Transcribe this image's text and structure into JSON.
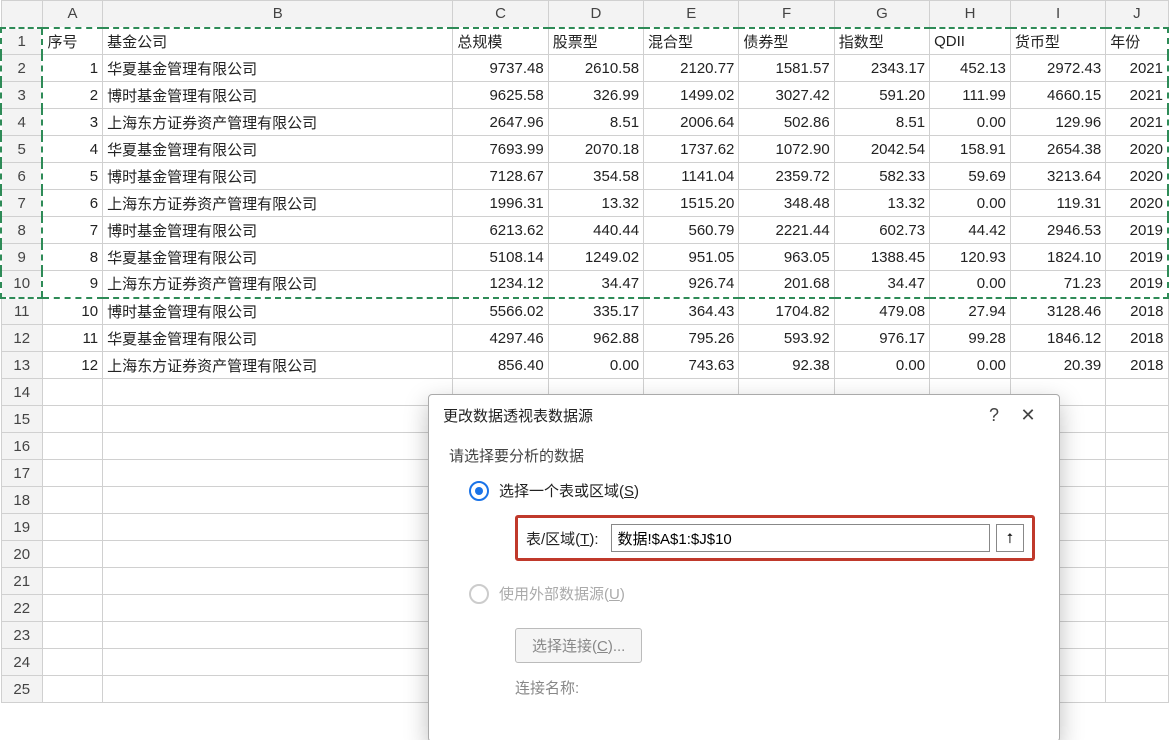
{
  "columns": {
    "letters": [
      "",
      "A",
      "B",
      "C",
      "D",
      "E",
      "F",
      "G",
      "H",
      "I",
      "J"
    ]
  },
  "headers": {
    "A": "序号",
    "B": "基金公司",
    "C": "总规模",
    "D": "股票型",
    "E": "混合型",
    "F": "债券型",
    "G": "指数型",
    "H": "QDII",
    "I": "货币型",
    "J": "年份"
  },
  "rows": [
    {
      "n": "1",
      "co": "华夏基金管理有限公司",
      "c": "9737.48",
      "d": "2610.58",
      "e": "2120.77",
      "f": "1581.57",
      "g": "2343.17",
      "h": "452.13",
      "i": "2972.43",
      "j": "2021"
    },
    {
      "n": "2",
      "co": "博时基金管理有限公司",
      "c": "9625.58",
      "d": "326.99",
      "e": "1499.02",
      "f": "3027.42",
      "g": "591.20",
      "h": "111.99",
      "i": "4660.15",
      "j": "2021"
    },
    {
      "n": "3",
      "co": "上海东方证券资产管理有限公司",
      "c": "2647.96",
      "d": "8.51",
      "e": "2006.64",
      "f": "502.86",
      "g": "8.51",
      "h": "0.00",
      "i": "129.96",
      "j": "2021"
    },
    {
      "n": "4",
      "co": "华夏基金管理有限公司",
      "c": "7693.99",
      "d": "2070.18",
      "e": "1737.62",
      "f": "1072.90",
      "g": "2042.54",
      "h": "158.91",
      "i": "2654.38",
      "j": "2020"
    },
    {
      "n": "5",
      "co": "博时基金管理有限公司",
      "c": "7128.67",
      "d": "354.58",
      "e": "1141.04",
      "f": "2359.72",
      "g": "582.33",
      "h": "59.69",
      "i": "3213.64",
      "j": "2020"
    },
    {
      "n": "6",
      "co": "上海东方证券资产管理有限公司",
      "c": "1996.31",
      "d": "13.32",
      "e": "1515.20",
      "f": "348.48",
      "g": "13.32",
      "h": "0.00",
      "i": "119.31",
      "j": "2020"
    },
    {
      "n": "7",
      "co": "博时基金管理有限公司",
      "c": "6213.62",
      "d": "440.44",
      "e": "560.79",
      "f": "2221.44",
      "g": "602.73",
      "h": "44.42",
      "i": "2946.53",
      "j": "2019"
    },
    {
      "n": "8",
      "co": "华夏基金管理有限公司",
      "c": "5108.14",
      "d": "1249.02",
      "e": "951.05",
      "f": "963.05",
      "g": "1388.45",
      "h": "120.93",
      "i": "1824.10",
      "j": "2019"
    },
    {
      "n": "9",
      "co": "上海东方证券资产管理有限公司",
      "c": "1234.12",
      "d": "34.47",
      "e": "926.74",
      "f": "201.68",
      "g": "34.47",
      "h": "0.00",
      "i": "71.23",
      "j": "2019"
    },
    {
      "n": "10",
      "co": "博时基金管理有限公司",
      "c": "5566.02",
      "d": "335.17",
      "e": "364.43",
      "f": "1704.82",
      "g": "479.08",
      "h": "27.94",
      "i": "3128.46",
      "j": "2018"
    },
    {
      "n": "11",
      "co": "华夏基金管理有限公司",
      "c": "4297.46",
      "d": "962.88",
      "e": "795.26",
      "f": "593.92",
      "g": "976.17",
      "h": "99.28",
      "i": "1846.12",
      "j": "2018"
    },
    {
      "n": "12",
      "co": "上海东方证券资产管理有限公司",
      "c": "856.40",
      "d": "0.00",
      "e": "743.63",
      "f": "92.38",
      "g": "0.00",
      "h": "0.00",
      "i": "20.39",
      "j": "2018"
    }
  ],
  "empty_rows": [
    "14",
    "15",
    "16",
    "17",
    "18",
    "19",
    "20",
    "21",
    "22",
    "23",
    "24",
    "25"
  ],
  "dialog": {
    "title": "更改数据透视表数据源",
    "help": "?",
    "close": "✕",
    "prompt": "请选择要分析的数据",
    "opt1_prefix": "选择一个表或区域(",
    "opt1_u": "S",
    "opt1_suffix": ")",
    "range_label_prefix": "表/区域(",
    "range_label_u": "T",
    "range_label_suffix": "):",
    "range_value": "数据!$A$1:$J$10",
    "pick_icon": "⭡",
    "opt2_prefix": "使用外部数据源(",
    "opt2_u": "U",
    "opt2_suffix": ")",
    "conn_btn_prefix": "选择连接(",
    "conn_btn_u": "C",
    "conn_btn_suffix": ")...",
    "conn_name": "连接名称:"
  }
}
